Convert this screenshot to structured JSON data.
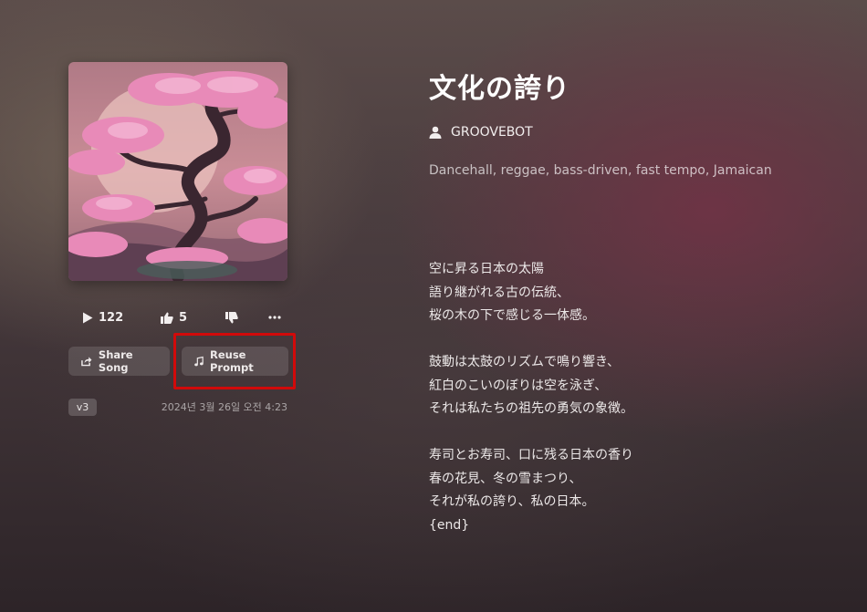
{
  "song": {
    "title": "文化の誇り",
    "artist": "GROOVEBOT",
    "style": "Dancehall, reggae, bass-driven, fast tempo, Jamaican",
    "lyrics": "空に昇る日本の太陽\n語り継がれる古の伝統、\n桜の木の下で感じる一体感。\n\n鼓動は太鼓のリズムで鳴り響き、\n紅白のこいのぼりは空を泳ぎ、\nそれは私たちの祖先の勇気の象徴。\n\n寿司とお寿司、口に残る日本の香り\n春の花見、冬の雪まつり、\nそれが私の誇り、私の日本。\n{end}",
    "version": "v3",
    "date": "2024년 3월 26일 오전 4:23",
    "cover_art": "cherry-blossom-tree"
  },
  "stats": {
    "plays": "122",
    "likes": "5"
  },
  "actions": {
    "share_label": "Share Song",
    "reuse_label": "Reuse Prompt"
  },
  "colors": {
    "highlight": "#d10a0a",
    "blossom": "#e88ab8"
  }
}
